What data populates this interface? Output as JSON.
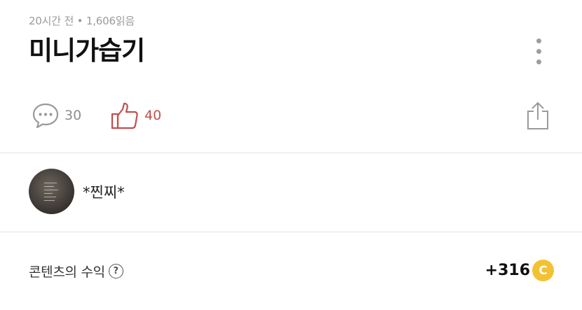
{
  "post": {
    "time_ago": "20시간 전",
    "separator": "•",
    "reads": "1,606읽음",
    "title": "미니가습기"
  },
  "actions": {
    "comment_count": "30",
    "like_count": "40"
  },
  "author": {
    "name": "*찐찌*"
  },
  "revenue": {
    "label": "콘텐츠의 수익",
    "help_symbol": "?",
    "amount": "+316",
    "coin_symbol": "C"
  },
  "colors": {
    "like_accent": "#c0504d",
    "coin": "#f2c232",
    "muted_text": "#9a9a9a"
  },
  "icons": [
    "more-vertical-icon",
    "comment-icon",
    "thumbs-up-icon",
    "share-icon",
    "help-icon",
    "coin-icon"
  ]
}
